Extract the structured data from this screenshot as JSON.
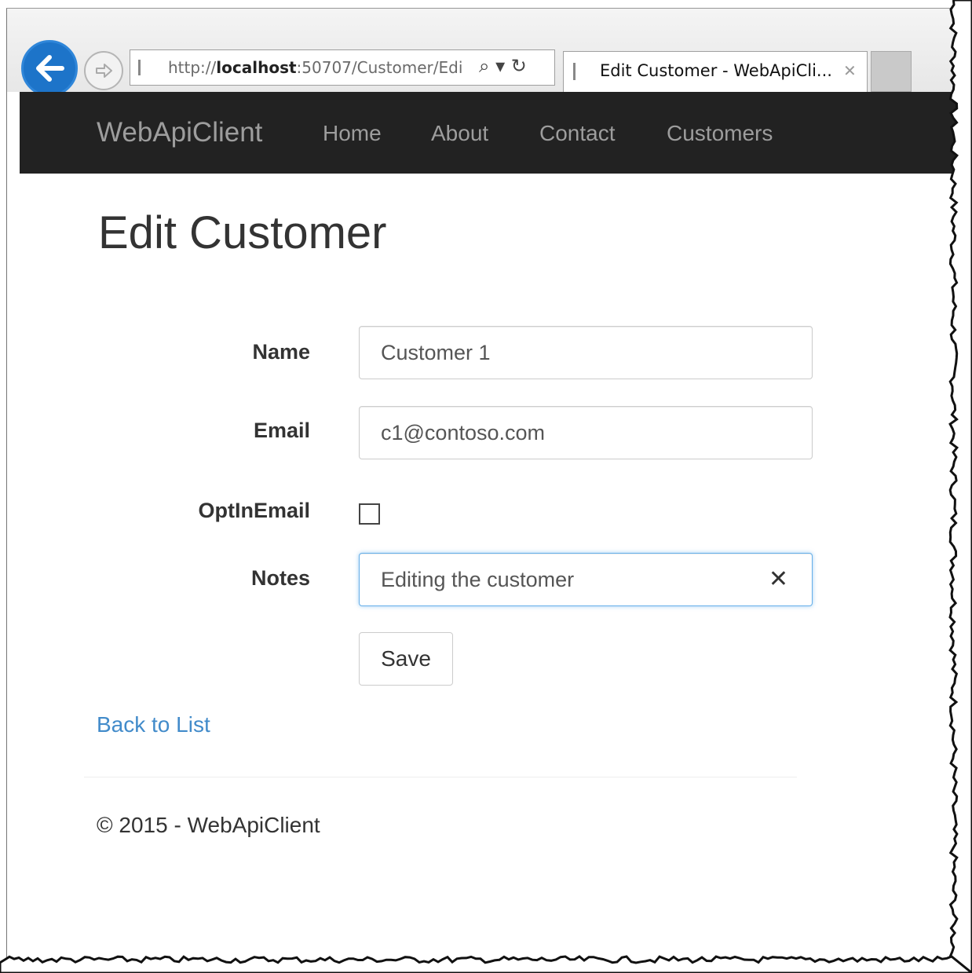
{
  "browser": {
    "address_url_plain": "http://",
    "address_url_host": "localhost",
    "address_url_rest": ":50707/Customer/Edi",
    "address_tools": "⌕ ▾ ↻",
    "tab_title": "Edit Customer - WebApiCli...",
    "tab_close": "✕"
  },
  "navbar": {
    "brand": "WebApiClient",
    "items": [
      "Home",
      "About",
      "Contact",
      "Customers"
    ]
  },
  "page": {
    "title": "Edit Customer",
    "fields": {
      "name_label": "Name",
      "name_value": "Customer 1",
      "email_label": "Email",
      "email_value": "c1@contoso.com",
      "optin_label": "OptInEmail",
      "optin_checked": false,
      "notes_label": "Notes",
      "notes_value": "Editing the customer",
      "notes_clear": "✕"
    },
    "save_label": "Save",
    "back_link": "Back to List",
    "footer": "© 2015 - WebApiClient"
  },
  "colors": {
    "navbar_bg": "#222222",
    "nav_text": "#9d9d9d",
    "link": "#428bca",
    "back_button": "#1d74c9"
  }
}
